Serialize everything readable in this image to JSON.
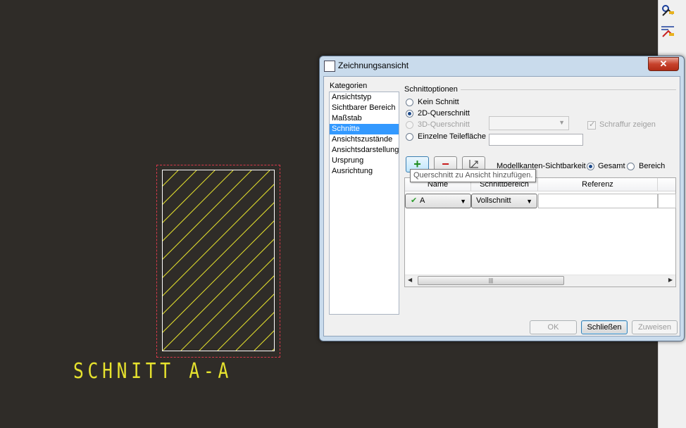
{
  "drawing": {
    "section_label": "SCHNITT A-A",
    "hatch_color": "#e6e22e",
    "frame_color": "#d8384a"
  },
  "right_toolbar": {
    "icons": [
      "view-tool-icon",
      "dimension-tool-icon"
    ]
  },
  "dialog": {
    "title": "Zeichnungsansicht",
    "close_label": "✕",
    "categories_label": "Kategorien",
    "categories": [
      "Ansichtstyp",
      "Sichtbarer Bereich",
      "Maßstab",
      "Schnitte",
      "Ansichtszustände",
      "Ansichtsdarstellung",
      "Ursprung",
      "Ausrichtung"
    ],
    "selected_category": "Schnitte",
    "section_options": {
      "group_label": "Schnittoptionen",
      "kein": "Kein Schnitt",
      "q2d": "2D-Querschnitt",
      "q3d": "3D-Querschnitt",
      "einzel": "Einzelne Teilefläche",
      "schraffur": "Schraffur zeigen",
      "selected": "2D-Querschnitt"
    },
    "toolbar": {
      "add_label": "+",
      "remove_label": "−",
      "tooltip": "Querschnitt zu Ansicht hinzufügen.",
      "visibility_label": "Modellkanten-Sichtbarkeit",
      "gesamt": "Gesamt",
      "bereich": "Bereich",
      "visibility_selected": "Gesamt"
    },
    "table": {
      "columns": [
        "Name",
        "Schnittbereich",
        "Referenz"
      ],
      "rows": [
        {
          "name": "A",
          "area": "Vollschnitt",
          "reference": ""
        }
      ]
    },
    "buttons": {
      "ok": "OK",
      "close": "Schließen",
      "apply": "Zuweisen"
    }
  }
}
